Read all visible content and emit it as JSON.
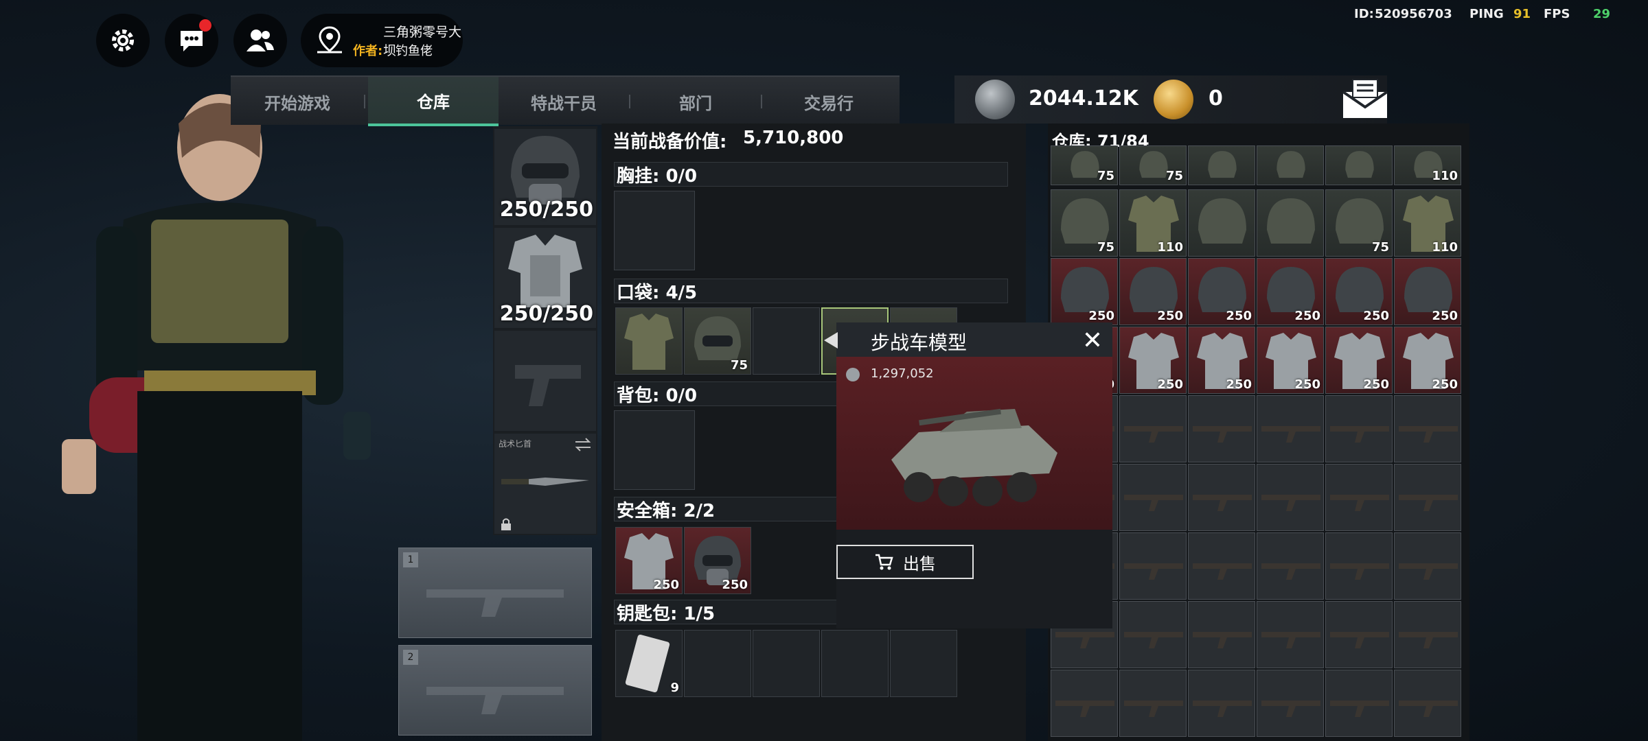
{
  "top_bar": {
    "map_name": "三角粥零号大坝",
    "author_label": "作者:",
    "author_name": "钓鱼佬",
    "id_label": "ID:",
    "id_value": "520956703",
    "ping_label": "PING",
    "ping_value": "91",
    "fps_label": "FPS",
    "fps_value": "29",
    "icons": [
      "gear-icon",
      "chat-icon",
      "friends-icon",
      "map-pin-icon"
    ]
  },
  "tabs": [
    {
      "label": "开始游戏",
      "active": false
    },
    {
      "label": "仓库",
      "active": true
    },
    {
      "label": "特战干员",
      "active": false
    },
    {
      "label": "部门",
      "active": false
    },
    {
      "label": "交易行",
      "active": false
    }
  ],
  "currency": {
    "silver_value": "2044.12K",
    "gold_value": "0",
    "mail_icon": "mail-icon"
  },
  "equipment": {
    "helmet_durability": "250/250",
    "armor_durability": "250/250",
    "melee_label": "战术匕首",
    "weapon_slots": [
      "1",
      "2"
    ]
  },
  "loadout": {
    "value_label": "当前战备价值:",
    "value": "5,710,800",
    "chest_rig": "胸挂: 0/0",
    "pockets": "口袋: 4/5",
    "pocket_counts": [
      "",
      "75",
      "",
      "",
      ""
    ],
    "backpack": "背包: 0/0",
    "safe_box": "安全箱: 2/2",
    "safe_counts": [
      "250",
      "250"
    ],
    "key_bag": "钥匙包: 1/5",
    "key_counts": [
      "9",
      "",
      "",
      "",
      ""
    ]
  },
  "warehouse": {
    "title": "仓库: 71/84",
    "row1_counts": [
      "75",
      "75",
      "",
      "",
      "",
      "110"
    ],
    "row2_counts": [
      "75",
      "110",
      "",
      "",
      "75",
      "110"
    ],
    "row3_counts": [
      "250",
      "250",
      "250",
      "250",
      "250",
      "250"
    ],
    "row4_counts": [
      "0",
      "250",
      "250",
      "250",
      "250",
      "250"
    ]
  },
  "popup": {
    "title": "步战车模型",
    "price": "1,297,052",
    "sell_label": "出售"
  },
  "colors": {
    "accent_green": "#4cc49a",
    "gold": "#f2b320",
    "ping_yellow": "#e8c02a",
    "fps_green": "#4ed16a",
    "red_cell": "#5a2428"
  }
}
